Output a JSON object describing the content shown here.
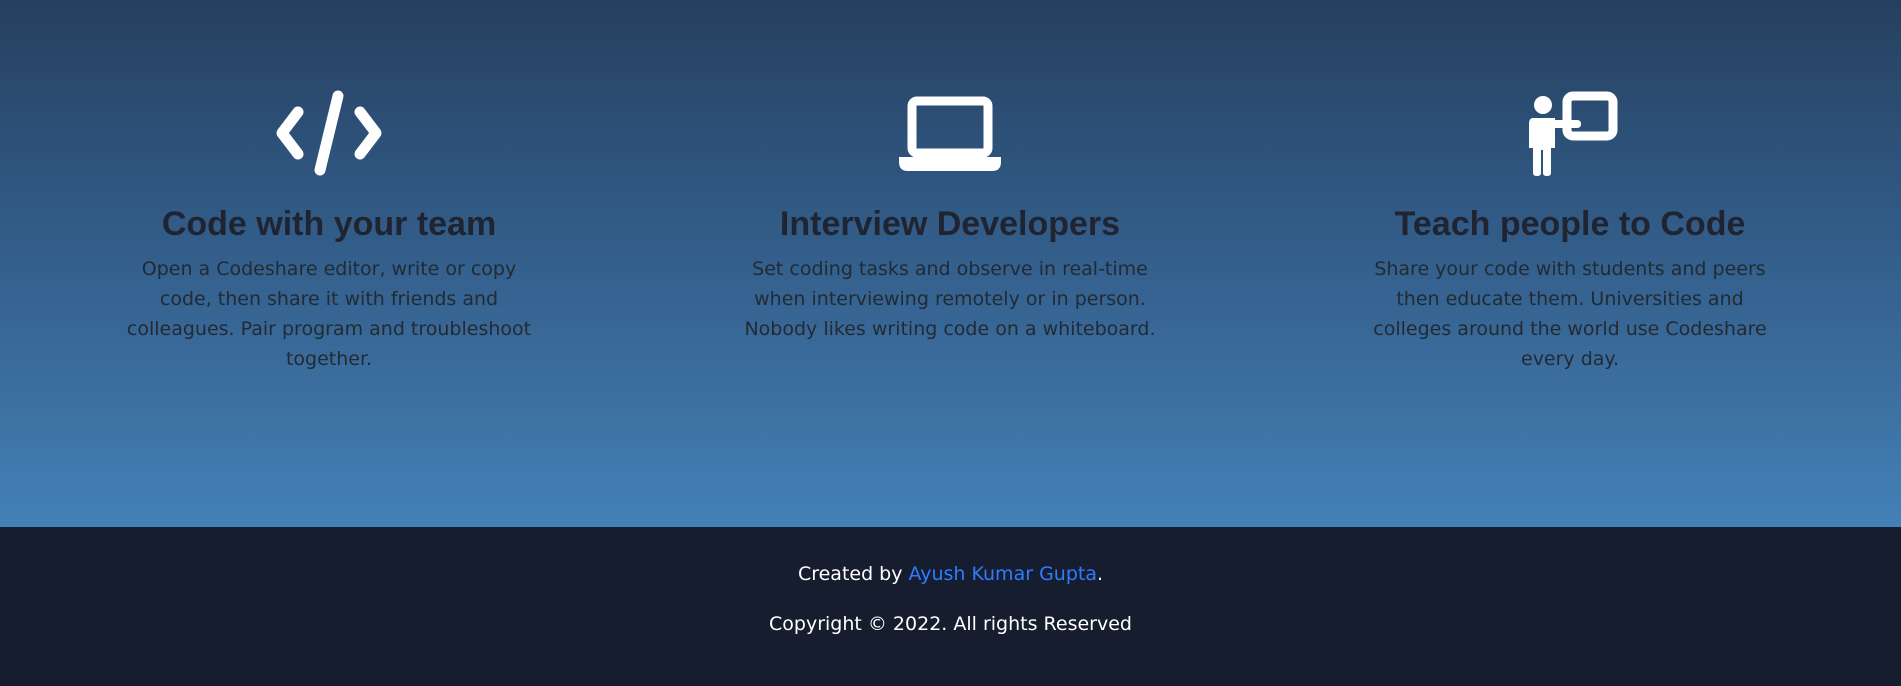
{
  "features": [
    {
      "icon": "code-icon",
      "title": "Code with your team",
      "description": "Open a Codeshare editor, write or copy code, then share it with friends and colleagues. Pair program and troubleshoot together."
    },
    {
      "icon": "laptop-icon",
      "title": "Interview Developers",
      "description": "Set coding tasks and observe in real-time when interviewing remotely or in person. Nobody likes writing code on a whiteboard."
    },
    {
      "icon": "teacher-icon",
      "title": "Teach people to Code",
      "description": "Share your code with students and peers then educate them. Universities and colleges around the world use Codeshare every day."
    }
  ],
  "footer": {
    "created_prefix": "Created by ",
    "author_name": "Ayush Kumar Gupta",
    "created_suffix": ".",
    "copyright": "Copyright © 2022. All rights Reserved"
  },
  "colors": {
    "hero_top": "#26405f",
    "hero_bottom": "#4381b7",
    "footer_bg": "#161d2f",
    "link": "#2f7dff"
  }
}
